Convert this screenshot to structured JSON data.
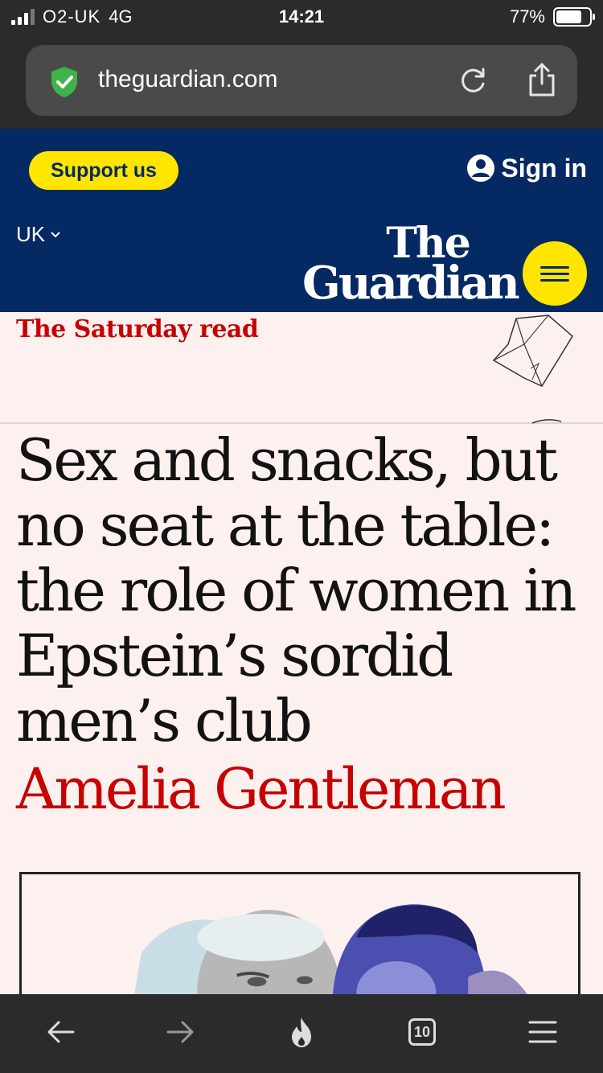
{
  "status_bar": {
    "carrier": "O2-UK",
    "network": "4G",
    "time": "14:21",
    "battery_percent": "77%",
    "battery_level": 0.77
  },
  "browser": {
    "url": "theguardian.com",
    "icons": [
      "shield-check-icon",
      "reload-icon",
      "share-icon"
    ]
  },
  "header": {
    "support_label": "Support us",
    "signin_label": "Sign in",
    "edition_label": "UK",
    "logo_top": "The",
    "logo_bottom": "Guardian"
  },
  "article": {
    "kicker": "The Saturday read",
    "headline": "Sex and snacks, but no seat at the table: the role of women in Epstein’s sordid men’s club",
    "byline": "Amelia Gentleman"
  },
  "toolbar": {
    "items": [
      "back-icon",
      "forward-icon",
      "flame-icon",
      "tabs-icon",
      "menu-icon"
    ],
    "tabs_count": "10"
  },
  "colors": {
    "guardian_blue": "#052962",
    "guardian_yellow": "#ffe500",
    "news_red": "#c70000",
    "page_bg": "#fdf1f0",
    "chrome_bg": "#2b2b2b"
  }
}
